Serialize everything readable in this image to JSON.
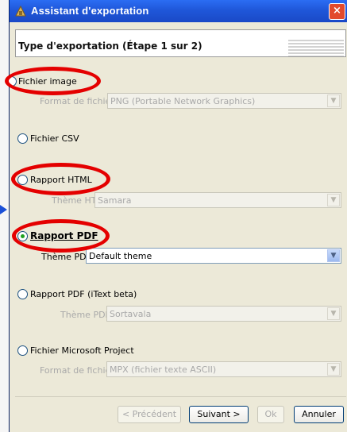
{
  "window": {
    "title": "Assistant d'exportation",
    "close_glyph": "×"
  },
  "header": {
    "title": "Type d'exportation  (Étape 1 sur 2)"
  },
  "options": {
    "image": {
      "label": "Fichier image",
      "sub_label": "Format de fichier",
      "sub_value": "PNG (Portable Network Graphics)",
      "selected": false
    },
    "csv": {
      "label": "Fichier CSV",
      "selected": false
    },
    "html": {
      "label": "Rapport HTML",
      "sub_label": "Thème HTML",
      "sub_value": "Samara",
      "selected": false
    },
    "pdf": {
      "label": "Rapport PDF",
      "sub_label": "Thème PDF",
      "sub_value": "Default theme",
      "selected": true
    },
    "itext": {
      "label": "Rapport PDF (iText beta)",
      "sub_label": "Thème PDF",
      "sub_value": "Sortavala",
      "selected": false
    },
    "msproject": {
      "label": "Fichier Microsoft Project",
      "sub_label": "Format de fichier",
      "sub_value": "MPX (fichier texte ASCII)",
      "selected": false
    }
  },
  "buttons": {
    "previous": "< Précédent",
    "next": "Suivant >",
    "ok": "Ok",
    "cancel": "Annuler"
  },
  "colors": {
    "annotation_ring": "#e40000",
    "selected_radio": "#21a121",
    "titlebar": "#2b6df3"
  },
  "icons": {
    "dropdown": "▼"
  }
}
